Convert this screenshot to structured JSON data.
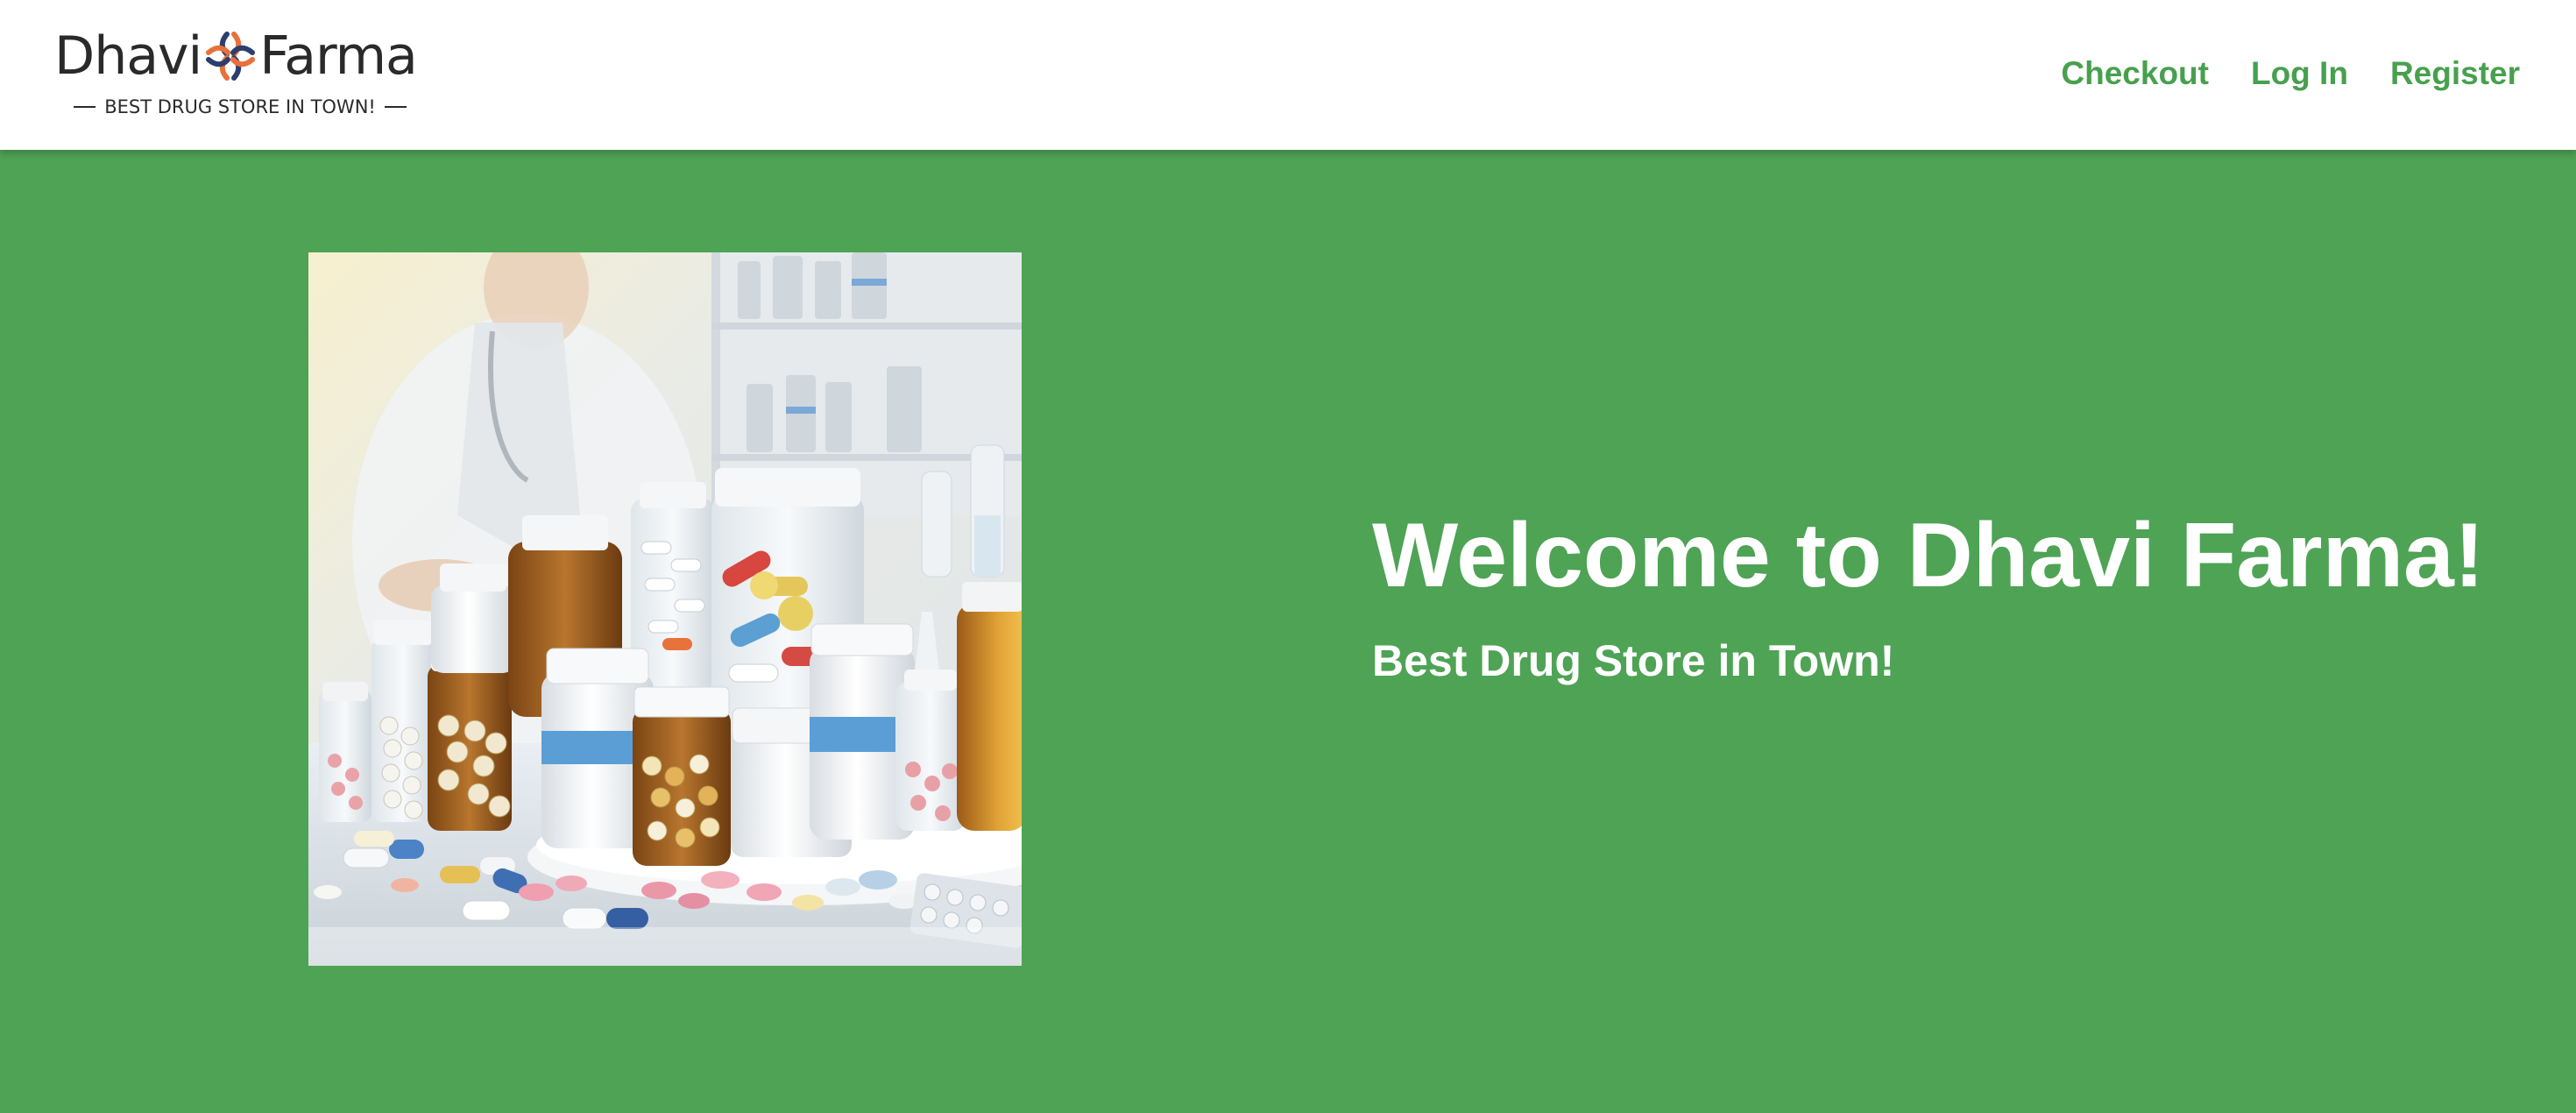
{
  "header": {
    "logo": {
      "name_part1": "Dhavi",
      "name_part2": "Farma",
      "tagline": "BEST DRUG STORE IN TOWN!",
      "mark_icon": "cross-plus-icon"
    },
    "nav": [
      {
        "label": "Checkout"
      },
      {
        "label": "Log In"
      },
      {
        "label": "Register"
      }
    ]
  },
  "hero": {
    "title": "Welcome to Dhavi Farma!",
    "subtitle": "Best Drug Store in Town!",
    "image_icon": "pharmacy-bottles-image"
  },
  "colors": {
    "hero_background": "#4ea354",
    "nav_link": "#47a04e",
    "header_background": "#ffffff",
    "logo_mark_orange": "#e8703a",
    "logo_mark_navy": "#2c3e6b"
  }
}
